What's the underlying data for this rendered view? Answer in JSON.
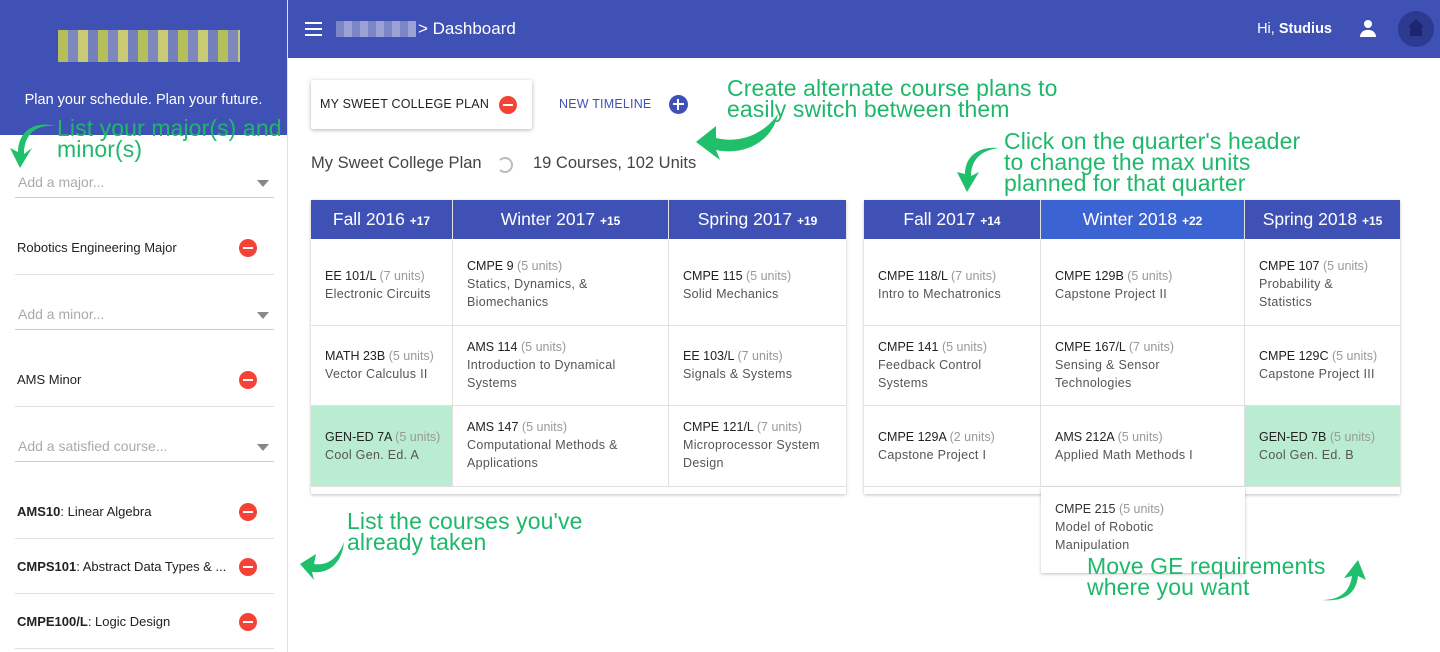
{
  "sidebar": {
    "tagline": "Plan your schedule. Plan your future.",
    "major_placeholder": "Add a major...",
    "minor_placeholder": "Add a minor...",
    "course_placeholder": "Add a satisfied course...",
    "major": "Robotics Engineering Major",
    "minor": "AMS Minor",
    "courses": [
      {
        "code": "AMS10",
        "name": ": Linear Algebra"
      },
      {
        "code": "CMPS101",
        "name": ": Abstract Data Types & ..."
      },
      {
        "code": "CMPE100/L",
        "name": ": Logic Design"
      }
    ]
  },
  "topbar": {
    "crumb": "> Dashboard",
    "greeting": "Hi, ",
    "user": "Studius"
  },
  "plan": {
    "card_label": "MY SWEET COLLEGE PLAN",
    "new_timeline": "NEW TIMELINE",
    "title": "My Sweet College Plan",
    "stats": "19 Courses, 102 Units"
  },
  "quarters": [
    {
      "name": "Fall 2016",
      "units": "+17",
      "courses": [
        {
          "code": "EE 101/L",
          "units": "(7 units)",
          "name": "Electronic Circuits"
        },
        {
          "code": "MATH 23B",
          "units": "(5 units)",
          "name": "Vector Calculus II"
        },
        {
          "code": "GEN-ED 7A",
          "units": "(5 units)",
          "name": "Cool Gen. Ed. A",
          "ge": true
        }
      ]
    },
    {
      "name": "Winter 2017",
      "units": "+15",
      "courses": [
        {
          "code": "CMPE 9",
          "units": "(5 units)",
          "name": "Statics, Dynamics, & Biomechanics"
        },
        {
          "code": "AMS 114",
          "units": "(5 units)",
          "name": "Introduction to Dynamical Systems"
        },
        {
          "code": "AMS 147",
          "units": "(5 units)",
          "name": "Computational Methods & Applications"
        }
      ]
    },
    {
      "name": "Spring 2017",
      "units": "+19",
      "courses": [
        {
          "code": "CMPE 115",
          "units": "(5 units)",
          "name": "Solid Mechanics"
        },
        {
          "code": "EE 103/L",
          "units": "(7 units)",
          "name": "Signals & Systems"
        },
        {
          "code": "CMPE 121/L",
          "units": "(7 units)",
          "name": "Microprocessor System Design"
        }
      ]
    },
    {
      "name": "Fall 2017",
      "units": "+14",
      "courses": [
        {
          "code": "CMPE 118/L",
          "units": "(7 units)",
          "name": "Intro to Mechatronics"
        },
        {
          "code": "CMPE 141",
          "units": "(5 units)",
          "name": "Feedback Control Systems"
        },
        {
          "code": "CMPE 129A",
          "units": "(2 units)",
          "name": "Capstone Project I"
        }
      ]
    },
    {
      "name": "Winter 2018",
      "units": "+22",
      "courses": [
        {
          "code": "CMPE 129B",
          "units": "(5 units)",
          "name": "Capstone Project II"
        },
        {
          "code": "CMPE 167/L",
          "units": "(7 units)",
          "name": "Sensing & Sensor Technologies"
        },
        {
          "code": "AMS 212A",
          "units": "(5 units)",
          "name": "Applied Math Methods I"
        },
        {
          "code": "CMPE 215",
          "units": "(5 units)",
          "name": "Model of Robotic Manipulation"
        }
      ]
    },
    {
      "name": "Spring 2018",
      "units": "+15",
      "courses": [
        {
          "code": "CMPE 107",
          "units": "(5 units)",
          "name": "Probability & Statistics"
        },
        {
          "code": "CMPE 129C",
          "units": "(5 units)",
          "name": "Capstone Project III"
        },
        {
          "code": "GEN-ED 7B",
          "units": "(5 units)",
          "name": "Cool Gen. Ed. B",
          "ge": true
        }
      ]
    }
  ],
  "annotations": {
    "majors_1": "List your major(s) and",
    "majors_2": "minor(s)",
    "alt_1": "Create alternate course plans to",
    "alt_2": "easily switch between them",
    "header_1": "Click on the quarter's header",
    "header_2": "to change the max units",
    "header_3": "planned for that quarter",
    "taken_1": "List the courses you've",
    "taken_2": "already taken",
    "ge_1": "Move GE requirements",
    "ge_2": "where you want"
  },
  "colors": {
    "primary": "#3f51b5",
    "danger": "#f44336",
    "ge": "#b9ecd0",
    "annotation": "#1fb86b"
  }
}
